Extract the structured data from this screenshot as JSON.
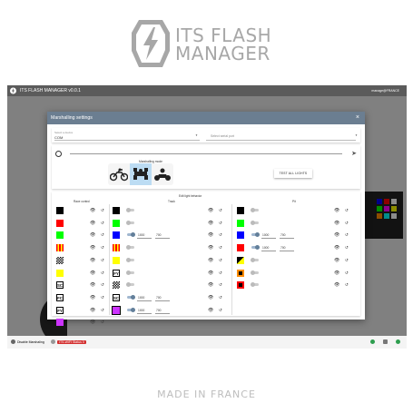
{
  "logo": {
    "line1": "ITS FLASH",
    "line2": "MANAGER"
  },
  "footer": {
    "text": "MADE IN FRANCE"
  },
  "app": {
    "title": "ITS FLASH MANAGER v0.0.1",
    "title_right": "manage@FRANCE",
    "status": {
      "item1": "Disable Marshaling",
      "item2": "ITS-WIFI Status",
      "badge": "0"
    }
  },
  "dialog": {
    "title": "Marshalling settings",
    "close": "×",
    "select_label": "Select a device",
    "select_value": "COM",
    "select_port_placeholder": "Select serial port",
    "mode_label": "Marshalling mode",
    "test_button": "TEST ALL LIGHTS",
    "edit_label": "Edit light behavior",
    "columns": {
      "race_control": "Race control",
      "track": "Track",
      "pit": "Pit"
    }
  },
  "colors": {
    "black": "#000000",
    "red": "#ff0000",
    "green": "#00ff00",
    "blue": "#0000ff",
    "yellow": "#ffff00",
    "orange": "#ff8c00",
    "purple": "#cc33ff",
    "accent": "#6b7e91"
  },
  "race_control_rows": [
    {
      "flag": "black-flag"
    },
    {
      "flag": "red-flag"
    },
    {
      "flag": "green-flag"
    },
    {
      "flag": "red-yellow-stripes-flag"
    },
    {
      "flag": "chequered-flag"
    },
    {
      "flag": "yellow-flag"
    },
    {
      "flag": "sc-flag",
      "text": "SC"
    },
    {
      "flag": "fcy-flag",
      "text": "FC"
    },
    {
      "flag": "fy-flag",
      "text": "FY"
    },
    {
      "flag": "purple-flag"
    }
  ],
  "track_rows": [
    {
      "flag": "black-flag",
      "on": false,
      "v1": "",
      "v2": ""
    },
    {
      "flag": "green-flag",
      "on": false,
      "v1": "",
      "v2": ""
    },
    {
      "flag": "blue-flag",
      "on": true,
      "v1": "1000",
      "v2": "700"
    },
    {
      "flag": "red-yellow-stripes-flag",
      "on": false,
      "v1": "",
      "v2": ""
    },
    {
      "flag": "yellow-flag",
      "on": false,
      "v1": "",
      "v2": ""
    },
    {
      "flag": "fy-flag",
      "on": false,
      "v1": "",
      "v2": "",
      "text": "FY"
    },
    {
      "flag": "chequered-flag",
      "on": false,
      "v1": "",
      "v2": ""
    },
    {
      "flag": "sc-flag",
      "on": true,
      "v1": "1000",
      "v2": "700",
      "text": "SC"
    },
    {
      "flag": "code60-flag",
      "on": true,
      "v1": "1000",
      "v2": "700"
    }
  ],
  "pit_rows": [
    {
      "flag": "black-flag",
      "on": false,
      "v1": "",
      "v2": ""
    },
    {
      "flag": "green-flag",
      "on": false,
      "v1": "",
      "v2": ""
    },
    {
      "flag": "blue-flag",
      "on": true,
      "v1": "1000",
      "v2": "700"
    },
    {
      "flag": "red-flag",
      "on": true,
      "v1": "1000",
      "v2": "700"
    },
    {
      "flag": "black-yellow-flag",
      "on": false,
      "v1": "",
      "v2": ""
    },
    {
      "flag": "black-orange-flag",
      "on": false,
      "v1": "",
      "v2": ""
    },
    {
      "flag": "black-red-flag",
      "on": false,
      "v1": "",
      "v2": ""
    }
  ]
}
